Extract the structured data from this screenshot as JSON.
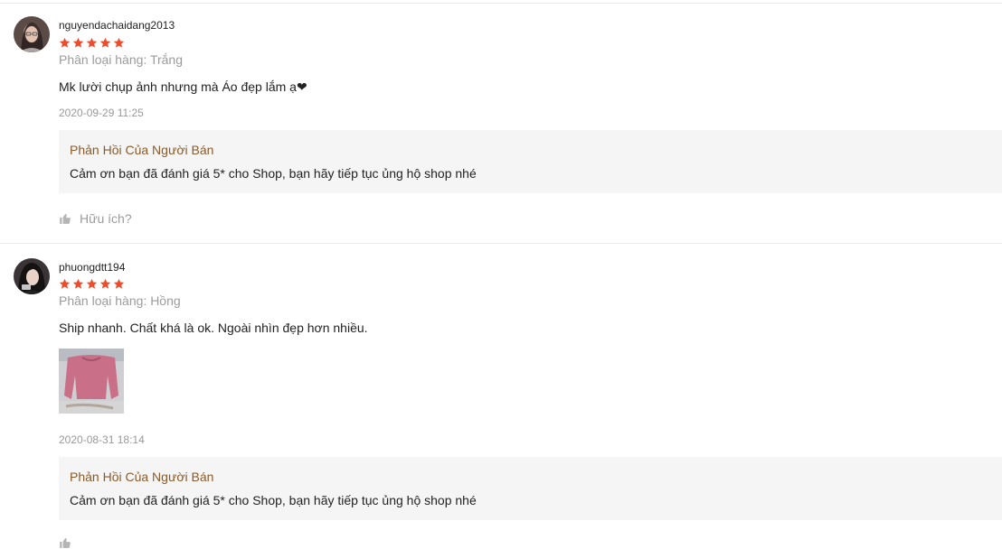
{
  "reviews": [
    {
      "username": "nguyendachaidang2013",
      "rating": 5,
      "variant": "Phân loại hàng: Trắng",
      "comment": "Mk lười chụp ảnh nhưng mà Áo đẹp lắm ạ❤",
      "time": "2020-09-29 11:25",
      "reply_title": "Phản Hồi Của Người Bán",
      "reply_text": "Cảm ơn bạn đã đánh giá 5* cho Shop, bạn hãy tiếp tục ủng hộ shop nhé",
      "helpful_label": "Hữu ích?"
    },
    {
      "username": "phuongdtt194",
      "rating": 5,
      "variant": "Phân loại hàng: Hồng",
      "comment": "Ship nhanh. Chất khá là ok. Ngoài nhìn đẹp hơn nhiều.",
      "time": "2020-08-31 18:14",
      "reply_title": "Phản Hồi Của Người Bán",
      "reply_text": "Cảm ơn bạn đã đánh giá 5* cho Shop, bạn hãy tiếp tục ủng hộ shop nhé"
    }
  ],
  "colors": {
    "star": "#ee4d2d",
    "reply_title": "#8a5a2b",
    "reply_bg": "#f5f5f5"
  },
  "icons": {
    "star": "star-icon",
    "helpful": "thumbs-up-icon"
  }
}
